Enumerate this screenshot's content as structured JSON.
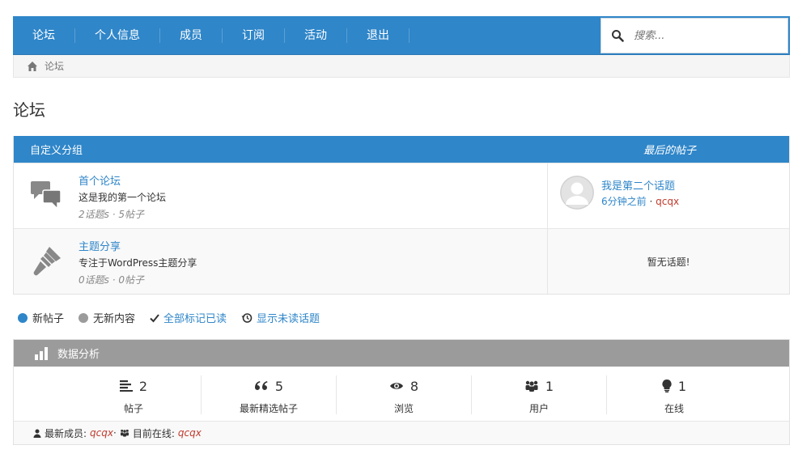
{
  "nav": {
    "items": [
      "论坛",
      "个人信息",
      "成员",
      "订阅",
      "活动",
      "退出"
    ],
    "search_placeholder": "搜索..."
  },
  "breadcrumb": {
    "label": "论坛"
  },
  "page_title": "论坛",
  "forum_table": {
    "group_header": "自定义分组",
    "last_post_header": "最后的帖子",
    "forums": [
      {
        "title": "首个论坛",
        "desc": "这是我的第一个论坛",
        "stats": "2话题s · 5帖子",
        "icon": "chat-bubbles-icon",
        "last_topic": "我是第二个话题",
        "last_time": "6分钟之前",
        "last_author": "qcqx"
      },
      {
        "title": "主题分享",
        "desc": "专注于WordPress主题分享",
        "stats": "0话题s · 0帖子",
        "icon": "paintbrush-icon",
        "no_topic": "暂无话题!"
      }
    ]
  },
  "legend": {
    "new_posts": "新帖子",
    "no_new": "无新内容",
    "mark_all_read": "全部标记已读",
    "show_unread": "显示未读话题",
    "colors": {
      "new": "#2f86c9",
      "none": "#9b9b9b"
    }
  },
  "stats": {
    "header": "数据分析",
    "cells": [
      {
        "value": "2",
        "label": "帖子",
        "icon": "list-icon"
      },
      {
        "value": "5",
        "label": "最新精选帖子",
        "icon": "quote-icon"
      },
      {
        "value": "8",
        "label": "浏览",
        "icon": "eye-icon"
      },
      {
        "value": "1",
        "label": "用户",
        "icon": "users-icon"
      },
      {
        "value": "1",
        "label": "在线",
        "icon": "lightbulb-icon"
      }
    ],
    "footer": {
      "newest_label": "最新成员:",
      "newest_user": "qcqx",
      "online_label": "目前在线:",
      "online_user": "qcqx"
    }
  },
  "colors": {
    "brand": "#2f86c9",
    "stats_header": "#9b9b9b",
    "author": "#c0392b"
  }
}
